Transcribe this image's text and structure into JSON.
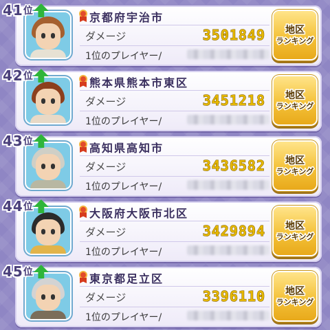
{
  "ranking": {
    "rank_suffix": "位",
    "damage_label": "ダメージ",
    "top_player_label": "1位のプレイヤー/",
    "button_line1": "地区",
    "button_line2": "ランキング",
    "rows": [
      {
        "rank": "41",
        "region": "京都府宇治市",
        "damage": "3501849",
        "avatar": {
          "hair": "#a5602f",
          "body": "#e7e1d3"
        }
      },
      {
        "rank": "42",
        "region": "熊本県熊本市東区",
        "damage": "3451218",
        "avatar": {
          "hair": "#8c3f1d",
          "body": "#e8d9c6"
        }
      },
      {
        "rank": "43",
        "region": "高知県高知市",
        "damage": "3436582",
        "avatar": {
          "hair": "#cfcfc6",
          "body": "#b8b7a2"
        }
      },
      {
        "rank": "44",
        "region": "大阪府大阪市北区",
        "damage": "3429894",
        "avatar": {
          "hair": "#2b2b2b",
          "body": "#e2b44a"
        }
      },
      {
        "rank": "45",
        "region": "東京都足立区",
        "damage": "3396110",
        "avatar": {
          "hair": "#d3d3d3",
          "body": "#7b6e5a"
        }
      }
    ]
  }
}
